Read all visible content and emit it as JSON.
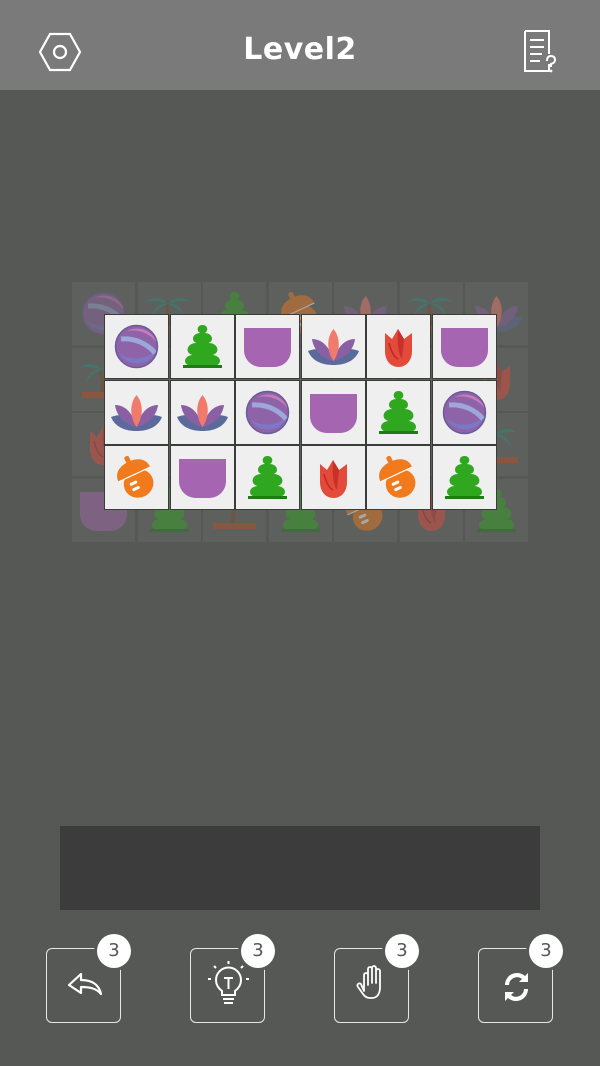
{
  "header": {
    "title": "Level2",
    "settings_icon": "hexagon-settings-icon",
    "rules_icon": "document-question-icon"
  },
  "board": {
    "back_layer": [
      [
        "ball",
        "palm",
        "tree",
        "acorn",
        "lotus",
        "palm",
        "lotus"
      ],
      [
        "palm",
        "",
        "",
        "",
        "",
        "",
        "tulip"
      ],
      [
        "tulip",
        "",
        "",
        "",
        "",
        "",
        "palm"
      ],
      [
        "pot",
        "tree",
        "palm",
        "tree",
        "acorn",
        "tulip",
        "tree"
      ]
    ],
    "front_layer": [
      [
        "ball",
        "tree",
        "pot",
        "lotus",
        "tulip",
        "pot"
      ],
      [
        "lotus",
        "lotus",
        "ball",
        "pot",
        "tree",
        "ball"
      ],
      [
        "acorn",
        "pot",
        "tree",
        "tulip",
        "acorn",
        "tree"
      ]
    ]
  },
  "powerups": [
    {
      "name": "undo",
      "icon": "undo-icon",
      "count": "3"
    },
    {
      "name": "hint",
      "icon": "lightbulb-icon",
      "count": "3"
    },
    {
      "name": "remove",
      "icon": "hand-icon",
      "count": "3"
    },
    {
      "name": "shuffle",
      "icon": "shuffle-icon",
      "count": "3"
    }
  ],
  "colors": {
    "background": "#565855",
    "header": "#7a7a7a",
    "tile": "#efefef",
    "tray": "#3c3c3c"
  }
}
